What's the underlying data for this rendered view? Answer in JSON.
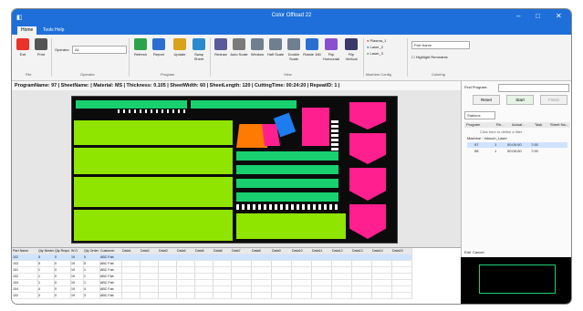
{
  "window": {
    "title": "Color Offload 22"
  },
  "tabs": [
    "Home",
    "Tools Help"
  ],
  "ribbon": {
    "file_buttons": [
      "Exit",
      "Print"
    ],
    "operator_label": "Operator",
    "operator_value": "All",
    "program_buttons": [
      "Refresh",
      "Report",
      "Update",
      "Swap Sheet"
    ],
    "view_buttons": [
      "Redraw",
      "Auto Scale",
      "Window",
      "Half Scale",
      "Double Scale",
      "Rotate 180",
      "Flip Horizontal",
      "Flip Vertical"
    ],
    "machines": [
      "Plasma_1",
      "Laser_2",
      "Laser_3"
    ],
    "part_name_select": "Part Name",
    "highlight_label": "Highlight Remnants",
    "groups": [
      "File",
      "Operator",
      "Program",
      "View",
      "Machine Config",
      "Coloring"
    ]
  },
  "infobar": {
    "text": "ProgramName: 97 | SheetName: | Material: MS | Thickness: 0.105 | SheetWidth: 60 | SheetLength: 120 | CuttingTime: 00:24:20 | RepeatID: 1 |"
  },
  "right": {
    "find_label": "Find Program:",
    "reset": "Reset",
    "start": "Start",
    "finish": "Finish",
    "station": "Stations",
    "cols": [
      "Program",
      "Re...",
      "Actual...",
      "Task",
      "Sheet Na..."
    ],
    "filter_hint": "Click here to define a filter",
    "machine_row": "Machine : Intouch_Laser",
    "rows": [
      [
        "97",
        "1",
        "00:00:00",
        "7:00"
      ],
      [
        "98",
        "1",
        "00:00:00",
        "7:00"
      ]
    ],
    "footer": [
      "Edit",
      "Cancel"
    ]
  },
  "grid": {
    "headers": [
      "Part Name",
      "Qty Nested",
      "Qty Requi...",
      "W.O",
      "Qty Order...",
      "Customer",
      "Data1",
      "Data2",
      "Data3",
      "Data4",
      "Data5",
      "Data6",
      "Data7",
      "Data8",
      "Data9",
      "Data10",
      "Data11",
      "Data12",
      "Data13",
      "Data14",
      "Data15"
    ],
    "rows": [
      [
        "102",
        "5",
        "0",
        "19",
        "5",
        "ABC Fab"
      ],
      [
        "103",
        "5",
        "0",
        "19",
        "5",
        "ABC Fab"
      ],
      [
        "101",
        "1",
        "0",
        "19",
        "1",
        "ABC Fab"
      ],
      [
        "102",
        "1",
        "0",
        "19",
        "1",
        "ABC Fab"
      ],
      [
        "104",
        "1",
        "0",
        "19",
        "1",
        "ABC Fab"
      ],
      [
        "104",
        "4",
        "0",
        "19",
        "4",
        "ABC Fab"
      ],
      [
        "102",
        "3",
        "0",
        "19",
        "3",
        "ABC Fab"
      ]
    ]
  },
  "colors": {
    "accent": "#1e6fd9",
    "lime": "#8fe400",
    "green": "#18d06f",
    "pink": "#ff1f8f",
    "orange": "#ff7a00",
    "blue": "#1c7cf0",
    "white": "#ffffff"
  }
}
